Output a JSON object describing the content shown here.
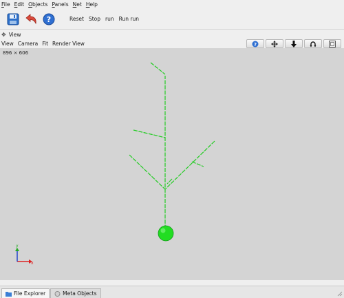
{
  "menubar": {
    "items": [
      "File",
      "Edit",
      "Objects",
      "Panels",
      "Net",
      "Help"
    ]
  },
  "toolbar": {
    "icons": [
      "save-icon",
      "undo-icon",
      "help-icon"
    ],
    "buttons": [
      "Reset",
      "Stop",
      "run",
      "Run run"
    ]
  },
  "view_panel": {
    "title": "View",
    "menu": [
      "View",
      "Camera",
      "Fit",
      "Render View"
    ],
    "tool_icons": [
      "help-icon",
      "move-icon",
      "down-arrow-icon",
      "rotate-icon",
      "screenshot-icon"
    ]
  },
  "viewport": {
    "dimensions": "896 × 606",
    "background": "#d4d4d4",
    "object_color": "#22cc22",
    "axes": {
      "x": "x",
      "y": "y"
    }
  },
  "bottom_tabs": {
    "tabs": [
      "File Explorer",
      "Meta Objects"
    ],
    "active": "File Explorer"
  }
}
